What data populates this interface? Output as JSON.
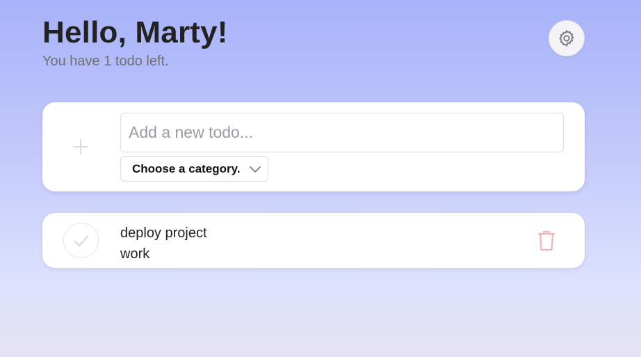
{
  "header": {
    "greeting": "Hello, Marty!",
    "subtitle": "You have 1 todo left."
  },
  "settings": {
    "icon": "gear-icon"
  },
  "add_todo": {
    "add_icon": "plus-icon",
    "input_placeholder": "Add a new todo...",
    "input_value": "",
    "category_select_label": "Choose a category.",
    "category_icon": "chevron-down-icon"
  },
  "todos": [
    {
      "title": "deploy project",
      "category": "work",
      "check_icon": "check-icon",
      "delete_icon": "trash-icon"
    }
  ],
  "colors": {
    "background_top": "#a7b2f9",
    "background_bottom": "#e5e2f3",
    "card": "#ffffff",
    "delete": "#f4b4b4",
    "muted_icon": "#d9d9d9",
    "heading": "#222222",
    "subtitle": "#707070"
  }
}
